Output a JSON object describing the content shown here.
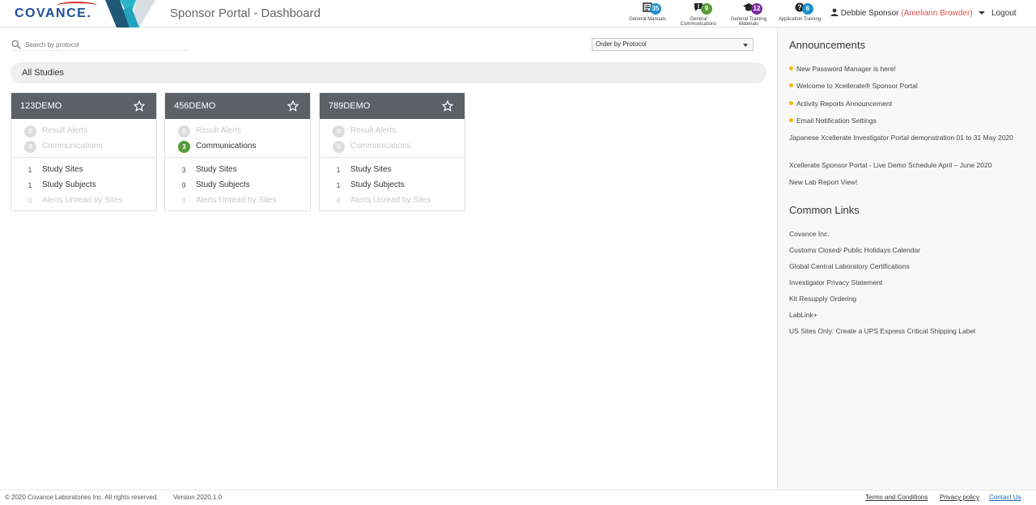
{
  "header": {
    "logo_text": "COVANCE.",
    "app_title": "Sponsor Portal - Dashboard",
    "icons": [
      {
        "icon": "manual-icon",
        "badge": "35",
        "badge_color": "#1a8fc9",
        "label": "General Manuals"
      },
      {
        "icon": "communication-icon",
        "badge": "9",
        "badge_color": "#5a9a3a",
        "label": "General Communications"
      },
      {
        "icon": "graduation-cap-icon",
        "badge": "12",
        "badge_color": "#7b2d9e",
        "label": "General Training Materials"
      },
      {
        "icon": "question-icon",
        "badge": "6",
        "badge_color": "#1a8fc9",
        "label": "Application Training"
      }
    ],
    "user_name": "Debbie Sponsor",
    "user_proxy": "(Ameliann Browder)",
    "logout": "Logout"
  },
  "main": {
    "search_placeholder": "Search by protocol",
    "order_by": "Order by Protocol",
    "all_studies": "All Studies",
    "cards": [
      {
        "title": "123DEMO",
        "result_alerts": "0",
        "communications": "0",
        "study_sites": "1",
        "study_subjects": "1",
        "alerts_unread": "0"
      },
      {
        "title": "456DEMO",
        "result_alerts": "0",
        "communications": "3",
        "study_sites": "3",
        "study_subjects": "9",
        "alerts_unread": "0"
      },
      {
        "title": "789DEMO",
        "result_alerts": "0",
        "communications": "0",
        "study_sites": "1",
        "study_subjects": "1",
        "alerts_unread": "0"
      }
    ],
    "labels": {
      "result_alerts": "Result Alerts",
      "communications": "Communications",
      "study_sites": "Study Sites",
      "study_subjects": "Study Subjects",
      "alerts_unread": "Alerts Unread by Sites"
    }
  },
  "sidebar": {
    "announcements_title": "Announcements",
    "announcements": [
      "New Password Manager is here!",
      "Welcome to Xcellerate® Sponsor Portal",
      "Activity Reports Announcement",
      "Email Notification Settings",
      "Japanese Xcellerate Investigator Portal demonstration 01 to 31 May 2020",
      "Xcellerate Sponsor Portal - Live Demo Schedule April – June 2020",
      "New Lab Report View!"
    ],
    "common_links_title": "Common Links",
    "common_links": [
      "Covance Inc.",
      "Customs Closed/ Public Holidays Calendar",
      "Global Central Laboratory Certifications",
      "Investigator Privacy Statement",
      "Kit Resupply Ordering",
      "LabLink+",
      "US Sites Only: Create a UPS Express Critical Shipping Label"
    ]
  },
  "footer": {
    "copyright": "© 2020 Covance Laboratories Inc. All rights reserved.",
    "version": "Version 2020.1.0",
    "terms": "Terms and Conditions",
    "privacy": "Privacy policy",
    "contact": "Contact Us"
  }
}
